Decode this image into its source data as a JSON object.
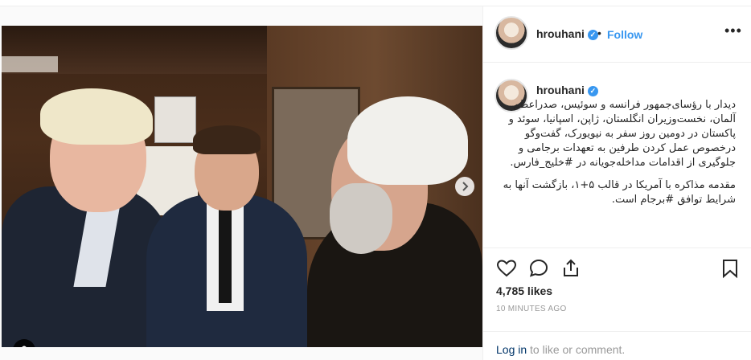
{
  "post": {
    "username": "hrouhani",
    "follow_label": "Follow",
    "separator": "•",
    "more_label": "•••",
    "caption_paragraph_1": "دیدار با رؤسای‌جمهور فرانسه و سوئیس، صدراعظم آلمان، نخست‌وزیران انگلستان، ژاپن، اسپانیا، سوئد و پاکستان در دومین روز سفر به نیویورک، گفت‌وگو درخصوص عمل کردن طرفین به تعهدات برجامی و جلوگیری از اقدامات مداخله‌جویانه در #خلیج_فارس.",
    "caption_paragraph_2": "مقدمه مذاکره با آمریکا در قالب ۵+۱، بازگشت آنها به شرایط توافق #برجام است.",
    "likes": "4,785 likes",
    "timestamp": "10 MINUTES AGO",
    "login_link": "Log in",
    "login_rest": " to like or comment."
  },
  "carousel": {
    "total": 9,
    "active": 0
  },
  "icons": {
    "verified": "verified-badge-icon",
    "heart": "heart-icon",
    "comment": "comment-icon",
    "share": "share-icon",
    "save": "bookmark-icon",
    "next": "chevron-right-icon",
    "tag": "user-tag-icon"
  },
  "colors": {
    "link_blue": "#3897f0",
    "text": "#262626",
    "muted": "#999999",
    "login_link": "#003569"
  }
}
